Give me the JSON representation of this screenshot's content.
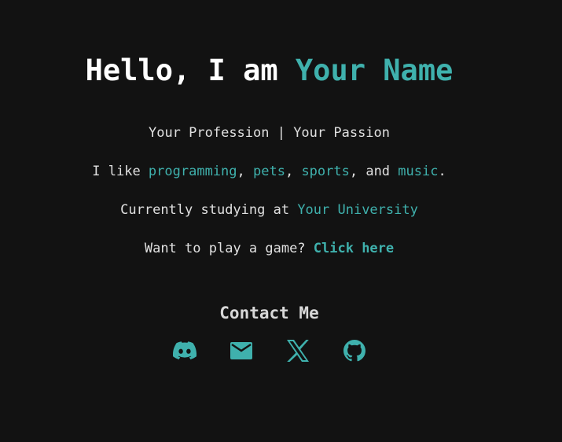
{
  "hero": {
    "greeting": "Hello, I am ",
    "name": "Your Name"
  },
  "profession_line": "Your Profession | Your Passion",
  "likes": {
    "prefix": "I like ",
    "items": [
      "programming",
      "pets",
      "sports",
      "music"
    ],
    "sep1": ", ",
    "sep2": ", ",
    "sep3": ", and ",
    "suffix": "."
  },
  "study": {
    "prefix": "Currently studying at ",
    "university": "Your University"
  },
  "game": {
    "prefix": "Want to play a game? ",
    "link": "Click here"
  },
  "contact": {
    "title": "Contact Me",
    "icons": [
      "discord-icon",
      "mail-icon",
      "x-icon",
      "github-icon"
    ]
  },
  "colors": {
    "background": "#121212",
    "accent": "#3fb1ad",
    "text": "#e0e0e0"
  }
}
